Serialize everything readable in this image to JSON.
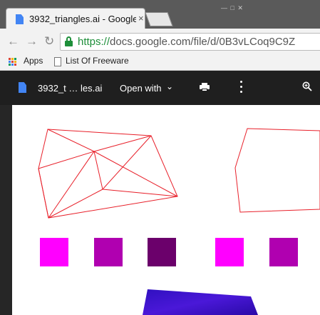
{
  "tab": {
    "title": "3932_triangles.ai - Google",
    "close": "×"
  },
  "window_controls": "— □ ✕",
  "nav": {
    "back": "←",
    "forward": "→",
    "reload": "↻"
  },
  "address": {
    "scheme": "https://",
    "rest": "docs.google.com/file/d/0B3vLCoq9C9Z"
  },
  "bookmarks": [
    {
      "label": "Apps"
    },
    {
      "label": "List Of Freeware"
    }
  ],
  "viewer": {
    "file_name": "3932_t … les.ai",
    "open_with": "Open with",
    "caret": "⌄"
  },
  "colors": {
    "swatch_magenta": "#ff00ff",
    "swatch_purple": "#b000b0",
    "swatch_dark_purple": "#6b006b",
    "line_red": "#e8202a"
  },
  "icons": [
    "doc-icon",
    "print-icon",
    "more-vert-icon",
    "zoom-icon",
    "lock-icon",
    "apps-icon",
    "page-icon"
  ]
}
